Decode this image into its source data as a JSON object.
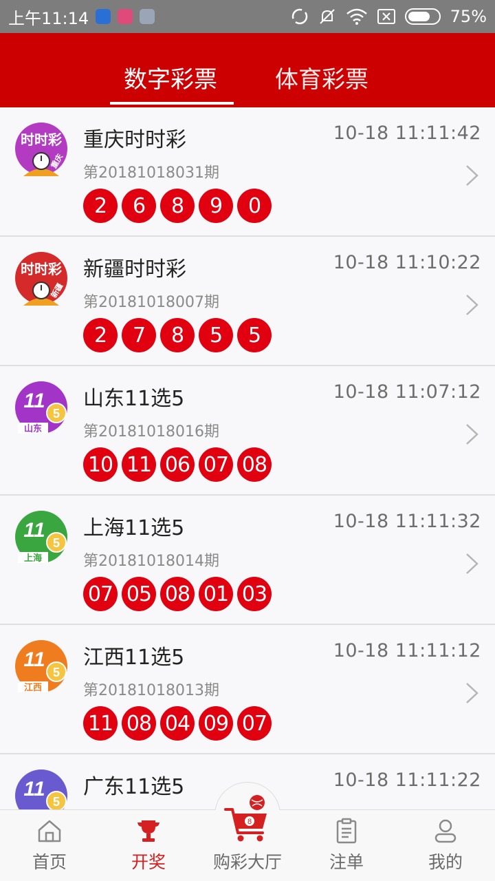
{
  "status_bar": {
    "time": "上午11:14",
    "battery": "75%",
    "battery_level": 0.75,
    "app_icon_colors": [
      "#2a6fd6",
      "#e04a7a",
      "#9aa6b8"
    ]
  },
  "header": {
    "tabs": [
      {
        "label": "数字彩票",
        "active": true
      },
      {
        "label": "体育彩票",
        "active": false
      }
    ],
    "color": "#cc0000"
  },
  "lotteries": [
    {
      "name": "重庆时时彩",
      "time": "10-18 11:11:42",
      "issue": "第20181018031期",
      "balls": [
        "2",
        "6",
        "8",
        "9",
        "0"
      ],
      "logo": {
        "type": "ssc",
        "color": "#b23bc2",
        "text": "时时彩",
        "region": "重庆"
      }
    },
    {
      "name": "新疆时时彩",
      "time": "10-18 11:10:22",
      "issue": "第20181018007期",
      "balls": [
        "2",
        "7",
        "8",
        "5",
        "5"
      ],
      "logo": {
        "type": "ssc",
        "color": "#d42a2a",
        "text": "时时彩",
        "region": "新疆"
      }
    },
    {
      "name": "山东11选5",
      "time": "10-18 11:07:12",
      "issue": "第20181018016期",
      "balls": [
        "10",
        "11",
        "06",
        "07",
        "08"
      ],
      "logo": {
        "type": "11x5",
        "color": "#a235c8",
        "text": "11",
        "sub": "5",
        "region": "山东"
      }
    },
    {
      "name": "上海11选5",
      "time": "10-18 11:11:32",
      "issue": "第20181018014期",
      "balls": [
        "07",
        "05",
        "08",
        "01",
        "03"
      ],
      "logo": {
        "type": "11x5",
        "color": "#3aa640",
        "text": "11",
        "sub": "5",
        "region": "上海"
      }
    },
    {
      "name": "江西11选5",
      "time": "10-18 11:11:12",
      "issue": "第20181018013期",
      "balls": [
        "11",
        "08",
        "04",
        "09",
        "07"
      ],
      "logo": {
        "type": "11x5",
        "color": "#ef7d1f",
        "text": "11",
        "sub": "5",
        "region": "江西"
      }
    },
    {
      "name": "广东11选5",
      "time": "10-18 11:11:22",
      "issue": "",
      "balls": [],
      "logo": {
        "type": "11x5",
        "color": "#6a5ad0",
        "text": "11",
        "sub": "5",
        "region": ""
      }
    }
  ],
  "bottom_nav": [
    {
      "label": "首页",
      "icon": "home-icon",
      "active": false
    },
    {
      "label": "开奖",
      "icon": "trophy-icon",
      "active": true
    },
    {
      "label": "购彩大厅",
      "icon": "cart-icon",
      "active": false
    },
    {
      "label": "注单",
      "icon": "clipboard-icon",
      "active": false
    },
    {
      "label": "我的",
      "icon": "user-icon",
      "active": false
    }
  ],
  "colors": {
    "ball": "#e1000f",
    "active_nav": "#d42020",
    "accent": "#cc0000"
  }
}
